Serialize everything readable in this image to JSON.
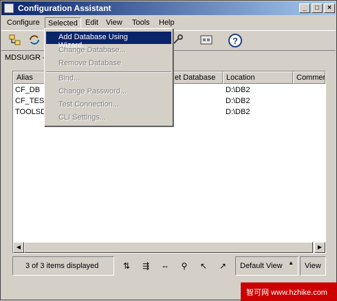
{
  "window": {
    "title": "Configuration Assistant"
  },
  "titlebar_buttons": {
    "minimize": "_",
    "maximize": "□",
    "close": "×"
  },
  "menubar": {
    "items": [
      "Configure",
      "Selected",
      "Edit",
      "View",
      "Tools",
      "Help"
    ]
  },
  "breadcrumb": "MDSUIGR - ",
  "table": {
    "columns": [
      "Alias",
      "et Database",
      "Location",
      "Commen"
    ],
    "rows": [
      {
        "alias": "CF_DB",
        "location": "D:\\DB2"
      },
      {
        "alias": "CF_TEST",
        "location": "D:\\DB2"
      },
      {
        "alias": "TOOLSD",
        "location": "D:\\DB2"
      }
    ]
  },
  "selected_menu": {
    "items": [
      {
        "label": "Add Database Using Wizard...",
        "state": "highlighted"
      },
      {
        "label": "Change Database...",
        "state": "disabled"
      },
      {
        "label": "Remove Database",
        "state": "disabled"
      },
      {
        "label": "Bind...",
        "state": "disabled"
      },
      {
        "label": "Change Password...",
        "state": "disabled"
      },
      {
        "label": "Test Connection...",
        "state": "disabled"
      },
      {
        "label": "CLI Settings...",
        "state": "disabled"
      }
    ]
  },
  "statusbar": {
    "count_text": "3 of 3 items displayed",
    "view_label": "Default View",
    "view_button": "View"
  },
  "watermark": {
    "text": "智可网 www.hzhike.com"
  },
  "colors": {
    "title_bar": "#0a246a",
    "highlight": "#0a246a",
    "face": "#d4d0c8"
  }
}
